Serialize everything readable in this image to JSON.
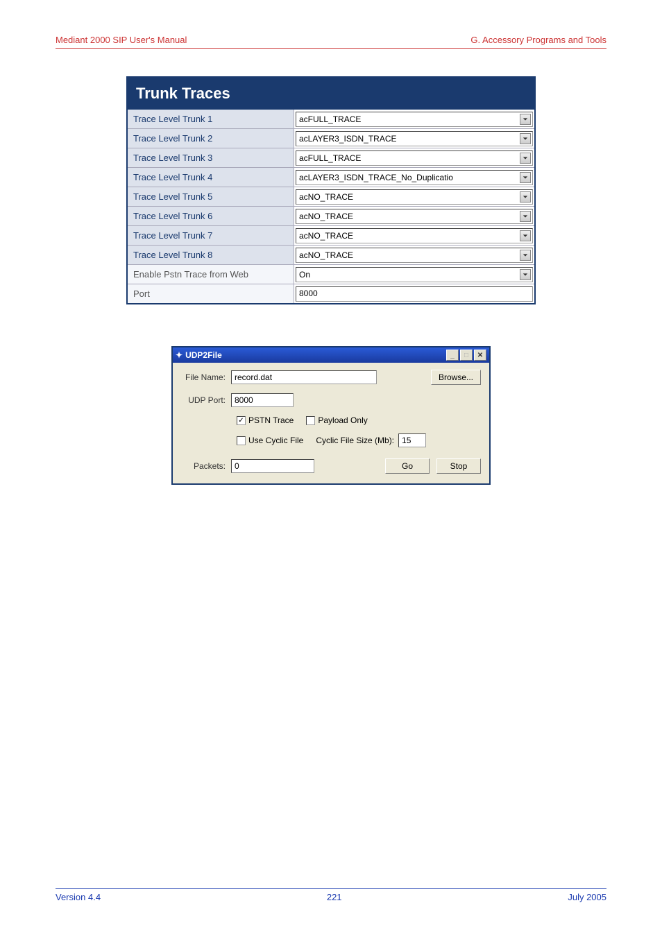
{
  "header": {
    "left": "Mediant 2000 SIP User's Manual",
    "right": "G. Accessory Programs and Tools"
  },
  "panel1": {
    "title": "Trunk Traces",
    "rows": [
      {
        "label": "Trace Level Trunk 1",
        "value": "acFULL_TRACE",
        "type": "select"
      },
      {
        "label": "Trace Level Trunk 2",
        "value": "acLAYER3_ISDN_TRACE",
        "type": "select"
      },
      {
        "label": "Trace Level Trunk 3",
        "value": "acFULL_TRACE",
        "type": "select"
      },
      {
        "label": "Trace Level Trunk 4",
        "value": "acLAYER3_ISDN_TRACE_No_Duplicatio",
        "type": "select"
      },
      {
        "label": "Trace Level Trunk 5",
        "value": "acNO_TRACE",
        "type": "select"
      },
      {
        "label": "Trace Level Trunk 6",
        "value": "acNO_TRACE",
        "type": "select"
      },
      {
        "label": "Trace Level Trunk 7",
        "value": "acNO_TRACE",
        "type": "select"
      },
      {
        "label": "Trace Level Trunk 8",
        "value": "acNO_TRACE",
        "type": "select"
      },
      {
        "label": "Enable Pstn Trace from Web",
        "value": "On",
        "type": "select",
        "light": true
      },
      {
        "label": "Port",
        "value": "8000",
        "type": "text",
        "light": true
      }
    ]
  },
  "panel2": {
    "title": "UDP2File",
    "fileNameLabel": "File Name:",
    "fileName": "record.dat",
    "browse": "Browse...",
    "udpPortLabel": "UDP Port:",
    "udpPort": "8000",
    "pstnTrace": "PSTN Trace",
    "pstnTraceChecked": true,
    "payloadOnly": "Payload Only",
    "payloadOnlyChecked": false,
    "useCyclic": "Use Cyclic File",
    "useCyclicChecked": false,
    "cyclicLabel": "Cyclic File Size (Mb):",
    "cyclicValue": "15",
    "packetsLabel": "Packets:",
    "packets": "0",
    "go": "Go",
    "stop": "Stop"
  },
  "footer": {
    "left": "Version 4.4",
    "center": "221",
    "right": "July 2005"
  }
}
